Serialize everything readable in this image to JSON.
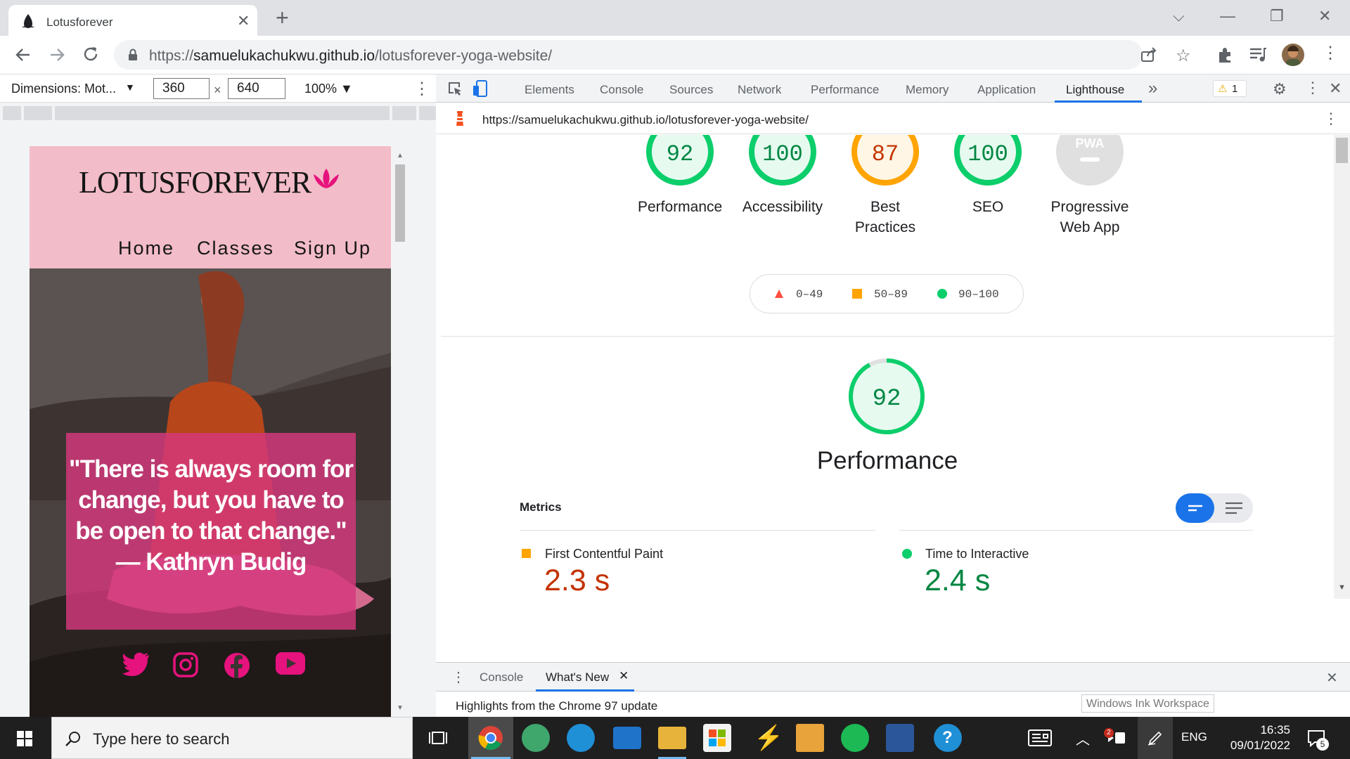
{
  "browser": {
    "tab_title": "Lotusforever",
    "url_prefix": "https://",
    "url_domain": "samuelukachukwu.github.io",
    "url_path": "/lotusforever-yoga-website/"
  },
  "device_toolbar": {
    "dimensions_label": "Dimensions: Mot...",
    "width": "360",
    "height": "640",
    "times": "×",
    "zoom": "100% ▼"
  },
  "site": {
    "logo": "LOTUSFOREVER",
    "nav": [
      "Home",
      "Classes",
      "Sign Up"
    ],
    "quote": "\"There is always room for change, but you have to be open to that change.\" — Kathryn Budig"
  },
  "devtools": {
    "tabs": [
      "Elements",
      "Console",
      "Sources",
      "Network",
      "Performance",
      "Memory",
      "Application",
      "Lighthouse"
    ],
    "active_tab": "Lighthouse",
    "more": "»",
    "warning_count": "1",
    "report_url": "https://samuelukachukwu.github.io/lotusforever-yoga-website/"
  },
  "lighthouse": {
    "scores": [
      {
        "label": "Performance",
        "value": "92",
        "status": "pass"
      },
      {
        "label": "Accessibility",
        "value": "100",
        "status": "pass"
      },
      {
        "label": "Best Practices",
        "value": "87",
        "status": "average"
      },
      {
        "label": "SEO",
        "value": "100",
        "status": "pass"
      },
      {
        "label": "Progressive Web App",
        "value": "PWA",
        "status": "na"
      }
    ],
    "legend": [
      "0–49",
      "50–89",
      "90–100"
    ],
    "perf_score": "92",
    "perf_title": "Performance",
    "metrics_label": "Metrics",
    "metrics": [
      {
        "name": "First Contentful Paint",
        "value": "2.3 s",
        "status": "average"
      },
      {
        "name": "Time to Interactive",
        "value": "2.4 s",
        "status": "pass"
      }
    ],
    "colors": {
      "pass": "#0cce6b",
      "pass_text": "#018642",
      "average": "#ffa400",
      "average_text": "#c33300",
      "fail": "#ff4e42"
    }
  },
  "drawer": {
    "tabs": [
      "Console",
      "What's New"
    ],
    "active": "What's New",
    "highlight": "Highlights from the Chrome 97 update",
    "ink_tooltip": "Windows Ink Workspace"
  },
  "taskbar": {
    "search_placeholder": "Type here to search",
    "language": "ENG",
    "time": "16:35",
    "date": "09/01/2022",
    "notification_count": "5",
    "mail_badge": "2"
  }
}
